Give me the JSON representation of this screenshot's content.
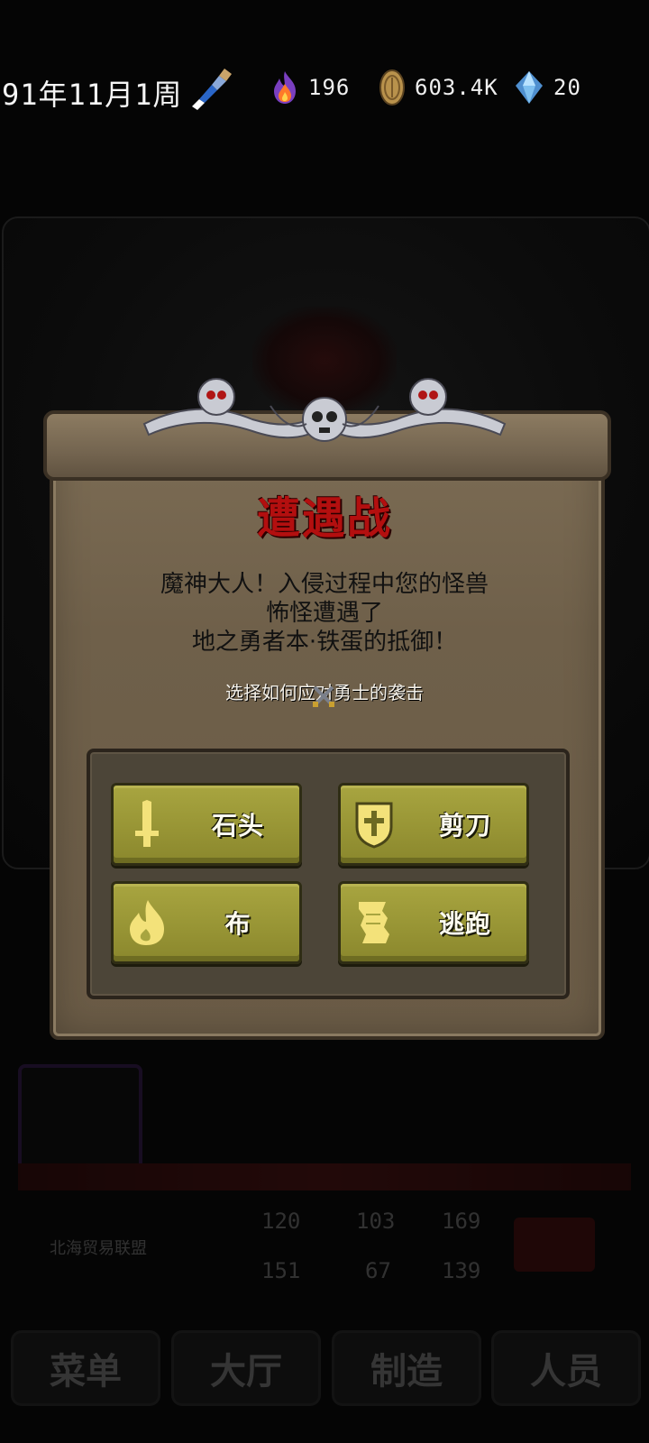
{
  "status_bar": {
    "date": "91年11月1周",
    "flame_value": "196",
    "coin_value": "603.4K",
    "gem_value": "20"
  },
  "dialog": {
    "title": "遭遇战",
    "message_lines": [
      "魔神大人！入侵过程中您的怪兽",
      "怖怪遭遇了",
      "地之勇者本·铁蛋的抵御！"
    ],
    "instruction": "选择如何应对勇士的袭击",
    "options": [
      {
        "label": "石头",
        "icon": "sword-icon"
      },
      {
        "label": "剪刀",
        "icon": "shield-icon"
      },
      {
        "label": "布",
        "icon": "flame-icon"
      },
      {
        "label": "逃跑",
        "icon": "scroll-icon"
      }
    ]
  },
  "background_hud": {
    "guild_name": "北海贸易联盟",
    "stats": [
      "120",
      "103",
      "169",
      "151",
      "67",
      "139"
    ],
    "nav": [
      "菜单",
      "大厅",
      "制造",
      "人员"
    ]
  },
  "colors": {
    "parchment": "#6f604a",
    "title_red": "#b30f0f",
    "button_olive": "#989535"
  }
}
